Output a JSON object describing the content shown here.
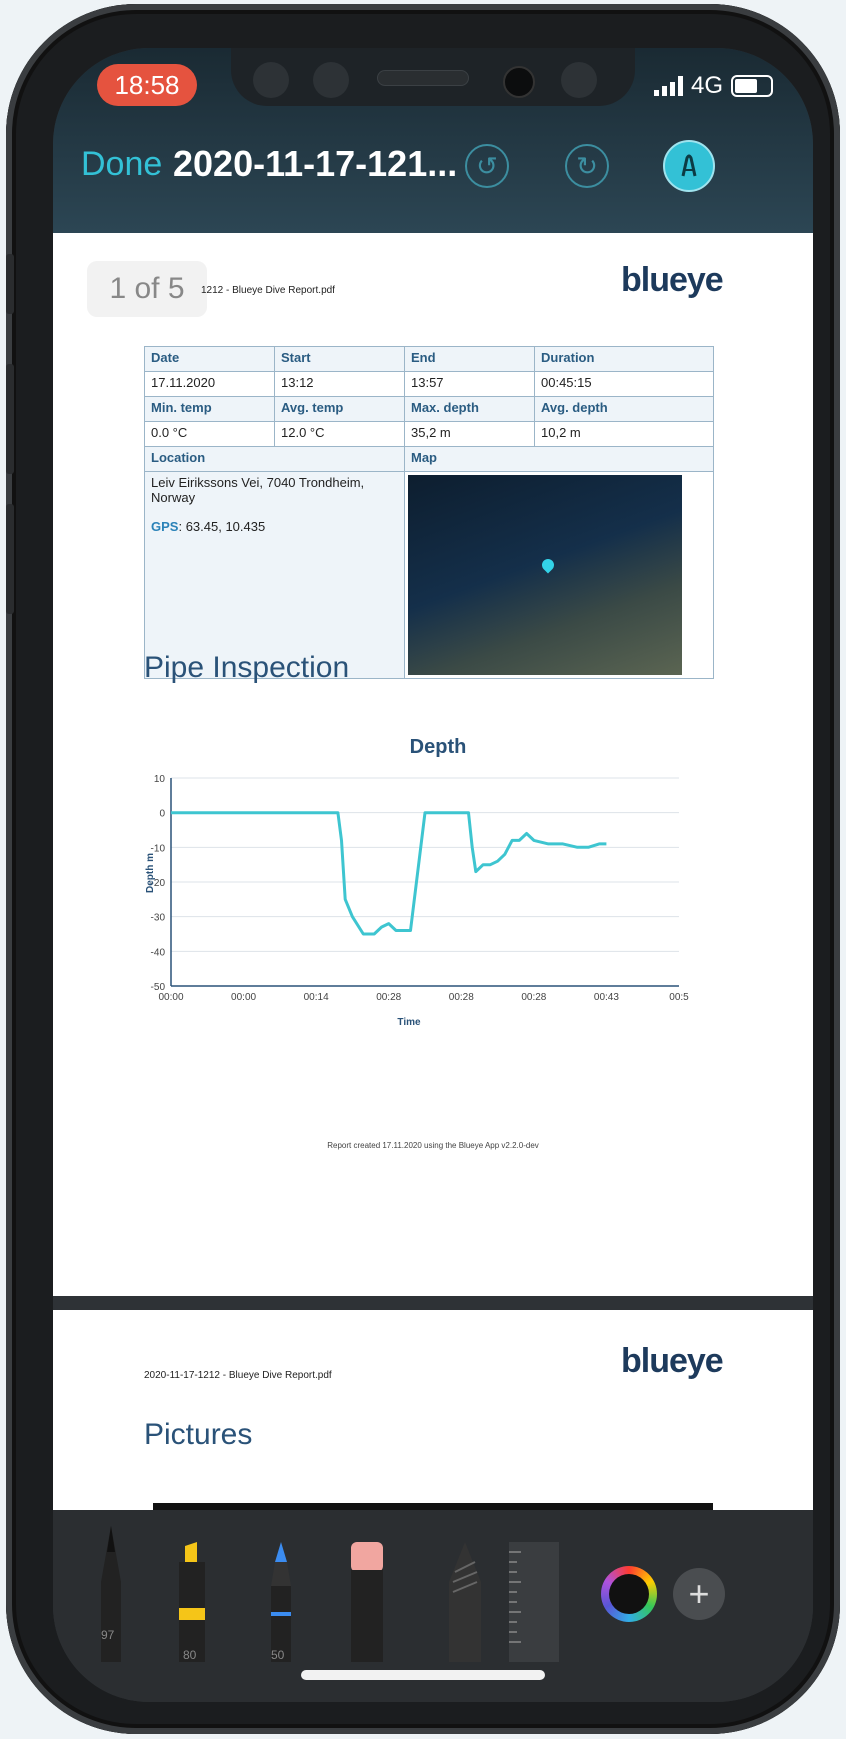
{
  "status": {
    "time": "18:58",
    "network": "4G"
  },
  "nav": {
    "done_label": "Done",
    "title": "2020-11-17-121..."
  },
  "page1": {
    "page_indicator": "1 of 5",
    "filename": "1212 - Blueye Dive Report.pdf",
    "logo": "blueye",
    "table": {
      "row1_headers": [
        "Date",
        "Start",
        "End",
        "Duration"
      ],
      "row1_values": [
        "17.11.2020",
        "13:12",
        "13:57",
        "00:45:15"
      ],
      "row2_headers": [
        "Min. temp",
        "Avg. temp",
        "Max. depth",
        "Avg. depth"
      ],
      "row2_values": [
        "0.0 °C",
        "12.0 °C",
        "35,2 m",
        "10,2 m"
      ],
      "location_label": "Location",
      "map_label": "Map",
      "address": "Leiv Eirikssons Vei, 7040 Trondheim, Norway",
      "gps_label": "GPS",
      "gps_value": ": 63.45, 10.435"
    },
    "section_title": "Pipe Inspection",
    "footer": "Report created 17.11.2020 using the Blueye App v2.2.0-dev"
  },
  "chart_data": {
    "type": "line",
    "title": "Depth",
    "xlabel": "Time",
    "ylabel": "Depth m",
    "ylim": [
      -50,
      10
    ],
    "yticks": [
      10,
      0,
      -10,
      -20,
      -30,
      -40,
      -50
    ],
    "xtick_labels": [
      "00:00",
      "00:00",
      "00:14",
      "00:28",
      "00:28",
      "00:28",
      "00:43",
      "00:5"
    ],
    "x": [
      0,
      0.3,
      0.6,
      0.8,
      1.0,
      1.15,
      1.3,
      1.45,
      1.6,
      1.8,
      2.0,
      2.1,
      2.2,
      2.3,
      2.35,
      2.4,
      2.5,
      2.65,
      2.8,
      2.9,
      3.0,
      3.1,
      3.3,
      3.5,
      3.7,
      3.9,
      4.1,
      4.15,
      4.2,
      4.3,
      4.4,
      4.5,
      4.6,
      4.7,
      4.8,
      4.9,
      5.0,
      5.2,
      5.4,
      5.6,
      5.75,
      5.9,
      6.0
    ],
    "y": [
      0,
      0,
      0,
      0,
      0,
      0,
      0,
      0,
      0,
      0,
      0,
      0,
      0,
      0,
      -8,
      -25,
      -30,
      -35,
      -35,
      -33,
      -32,
      -34,
      -34,
      0,
      0,
      0,
      0,
      -10,
      -17,
      -15,
      -15,
      -14,
      -12,
      -8,
      -8,
      -6,
      -8,
      -9,
      -9,
      -10,
      -10,
      -9,
      -9
    ],
    "grid": true,
    "series_color": "#3ec5d0"
  },
  "page2": {
    "filename": "2020-11-17-1212 - Blueye Dive Report.pdf",
    "logo": "blueye",
    "section_title": "Pictures"
  },
  "toolbar": {
    "pen_width": "97",
    "marker_width": "80",
    "pencil_width": "50",
    "plus_label": "+"
  }
}
